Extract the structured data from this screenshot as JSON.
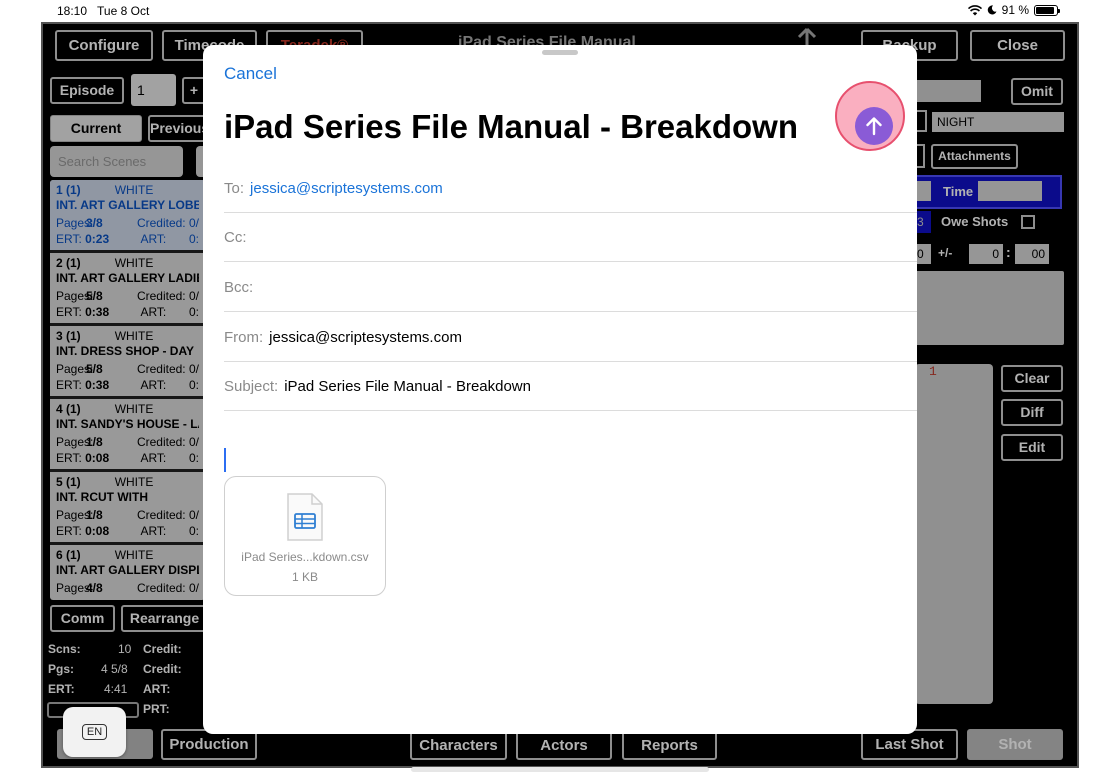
{
  "status_bar": {
    "time": "18:10",
    "date": "Tue 8 Oct",
    "battery": "91 %"
  },
  "app": {
    "title": "iPad Series File Manual",
    "top_buttons": {
      "configure": "Configure",
      "timecode": "Timecode",
      "teradek": "Teradek®",
      "backup": "Backup",
      "close": "Close"
    },
    "episode_label": "Episode",
    "episode_value": "1",
    "episode_plus": "+",
    "omit": "Omit",
    "tab_current": "Current",
    "tab_previous": "Previous",
    "search_placeholder": "Search Scenes",
    "night_value": "NIGHT",
    "attachments": "Attachments",
    "time_label": "Time",
    "owe_shots": "Owe Shots",
    "num3": "3",
    "plusminus": "+/-",
    "zero1": "0",
    "zero2": "0",
    "zero3": "00",
    "colon": ":",
    "number_red": "1",
    "clear": "Clear",
    "diff": "Diff",
    "edit": "Edit",
    "scenes": [
      {
        "num": "1 (1)",
        "color": "WHITE",
        "loc": "INT. ART GALLERY LOBBY",
        "pages": "3/8",
        "ert": "0:23",
        "selected": true
      },
      {
        "num": "2 (1)",
        "color": "WHITE",
        "loc": "INT. ART GALLERY LADIES",
        "pages": "5/8",
        "ert": "0:38",
        "selected": false
      },
      {
        "num": "3 (1)",
        "color": "WHITE",
        "loc": "INT. DRESS SHOP - DAY",
        "pages": "5/8",
        "ert": "0:38",
        "selected": false
      },
      {
        "num": "4 (1)",
        "color": "WHITE",
        "loc": "INT. SANDY'S HOUSE - LA",
        "pages": "1/8",
        "ert": "0:08",
        "selected": false
      },
      {
        "num": "5 (1)",
        "color": "WHITE",
        "loc": "INT. RCUT WITH",
        "pages": "1/8",
        "ert": "0:08",
        "selected": false
      },
      {
        "num": "6 (1)",
        "color": "WHITE",
        "loc": "INT. ART GALLERY DISPLAY",
        "pages": "4/8",
        "ert": "",
        "selected": false
      }
    ],
    "scene_keys": {
      "pages": "Pages:",
      "credited": "Credited:",
      "credited_val": "0/",
      "ert": "ERT:",
      "art": "ART:",
      "art_val": "0:"
    },
    "comm": "Comm",
    "rearrange": "Rearrange",
    "summary": {
      "scns_label": "Scns:",
      "scns_value": "10",
      "credit1": "Credit:",
      "pgs_label": "Pgs:",
      "pgs_value": "4 5/8",
      "credit2": "Credit:",
      "ert_label": "ERT:",
      "ert_value": "4:41",
      "art_label": "ART:",
      "prt_label": "PRT:"
    },
    "bottom_buttons": {
      "production": "Production",
      "characters": "Characters",
      "actors": "Actors",
      "reports": "Reports",
      "last_shot": "Last Shot",
      "shot": "Shot"
    }
  },
  "compose": {
    "cancel": "Cancel",
    "title": "iPad Series File Manual - Breakdown",
    "to_label": "To:",
    "to_value": "jessica@scriptesystems.com",
    "cc_label": "Cc:",
    "bcc_label": "Bcc:",
    "from_label": "From:",
    "from_value": "jessica@scriptesystems.com",
    "subject_label": "Subject:",
    "subject_value": "iPad Series File Manual - Breakdown",
    "attachment_name": "iPad Series...kdown.csv",
    "attachment_size": "1 KB",
    "send_icon": "arrow-up-icon",
    "accent_color": "#8a5bd6",
    "link_color": "#1a73d8"
  },
  "keyboard_lang": "EN"
}
